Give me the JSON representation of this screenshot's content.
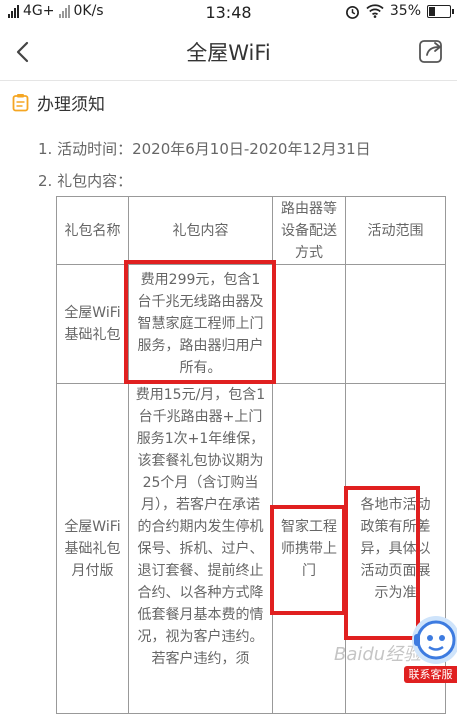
{
  "status": {
    "network": "4G+",
    "speed": "0K/s",
    "time": "13:48",
    "battery": "35%",
    "battery_level": 0.35
  },
  "nav": {
    "title": "全屋WiFi"
  },
  "section": {
    "title": "办理须知",
    "line1": "1. 活动时间：2020年6月10日-2020年12月31日",
    "line2": "2. 礼包内容："
  },
  "table": {
    "headers": {
      "name": "礼包名称",
      "content": "礼包内容",
      "delivery": "路由器等设备配送方式",
      "scope": "活动范围"
    },
    "rows": [
      {
        "name": "全屋WiFi基础礼包",
        "content": "费用299元，包含1台千兆无线路由器及智慧家庭工程师上门服务，路由器归用户所有。"
      },
      {
        "name": "全屋WiFi基础礼包月付版",
        "content": "费用15元/月，包含1台千兆路由器+上门服务1次+1年维保，该套餐礼包协议期为25个月（含订购当月），若客户在承诺的合约期内发生停机保号、拆机、过户、退订套餐、提前终止合约、以各种方式降低套餐月基本费的情况，视为客户违约。若客户违约，须",
        "delivery": "智家工程师携带上门",
        "scope": "各地市活动政策有所差异，具体以活动页面展示为准"
      }
    ]
  },
  "badge": {
    "label": "联系客服"
  },
  "watermark": "Baidu经验",
  "colors": {
    "highlight": "#e02020",
    "accent": "#f5a623"
  }
}
